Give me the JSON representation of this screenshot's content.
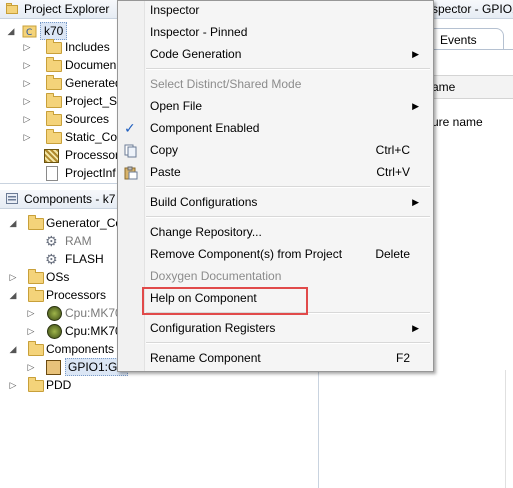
{
  "project_explorer": {
    "title": "Project Explorer",
    "root": "k70",
    "items": [
      "Includes",
      "Documen",
      "Generated",
      "Project_Se",
      "Sources",
      "Static_Co",
      "Processor",
      "ProjectInf"
    ]
  },
  "components": {
    "title": "Components - k7",
    "tree": [
      {
        "label": "Generator_Co",
        "level": 0
      },
      {
        "label": "RAM",
        "level": 1,
        "dim": true
      },
      {
        "label": "FLASH",
        "level": 1
      },
      {
        "label": "OSs",
        "level": 0
      },
      {
        "label": "Processors",
        "level": 0
      },
      {
        "label": "Cpu:MK70",
        "level": 1,
        "dim": true
      },
      {
        "label": "Cpu:MK70",
        "level": 1
      },
      {
        "label": "Components",
        "level": 0
      },
      {
        "label": "GPIO1:GP",
        "level": 1
      },
      {
        "label": "PDD",
        "level": 0
      }
    ]
  },
  "inspector": {
    "title": "spector - GPIO1",
    "tab_events": "Events",
    "col1": "ame",
    "col2": "ure name"
  },
  "context_menu": {
    "items": [
      {
        "label": "Inspector"
      },
      {
        "label": "Inspector - Pinned"
      },
      {
        "label": "Code Generation",
        "submenu": true
      },
      {
        "label": "Select Distinct/Shared Mode",
        "disabled": true
      },
      {
        "label": "Open File",
        "submenu": true
      },
      {
        "label": "Component Enabled",
        "checked": true
      },
      {
        "label": "Copy",
        "shortcut": "Ctrl+C"
      },
      {
        "label": "Paste",
        "shortcut": "Ctrl+V"
      },
      {
        "label": "Build Configurations",
        "submenu": true
      },
      {
        "label": "Change Repository..."
      },
      {
        "label": "Remove Component(s) from Project",
        "shortcut": "Delete"
      },
      {
        "label": "Doxygen Documentation",
        "disabled": true
      },
      {
        "label": "Help on Component"
      },
      {
        "label": "Configuration Registers",
        "submenu": true
      },
      {
        "label": "Rename Component",
        "shortcut": "F2"
      }
    ],
    "highlight_color": "#e14a4a",
    "check_color": "#1f5fbf"
  }
}
